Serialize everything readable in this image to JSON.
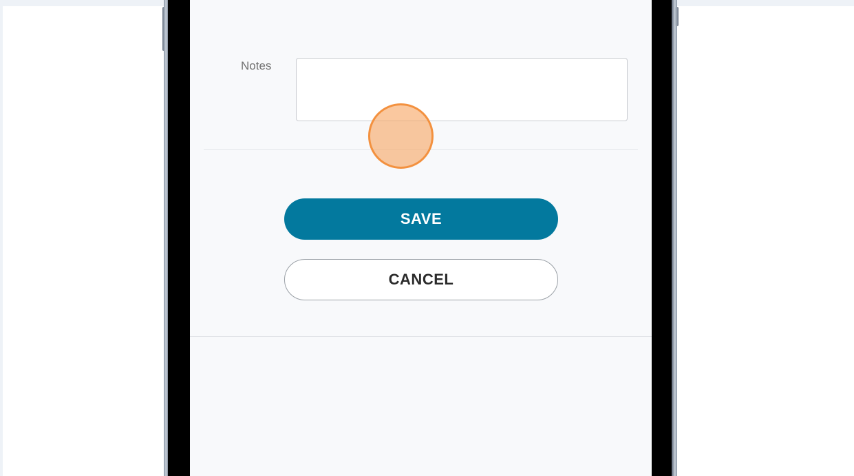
{
  "form": {
    "notes_label": "Notes",
    "notes_value": "",
    "save_label": "SAVE",
    "cancel_label": "CANCEL"
  },
  "colors": {
    "accent": "#03799e",
    "touch_indicator": "#f3913f",
    "screen_background": "#f8f9fb"
  }
}
